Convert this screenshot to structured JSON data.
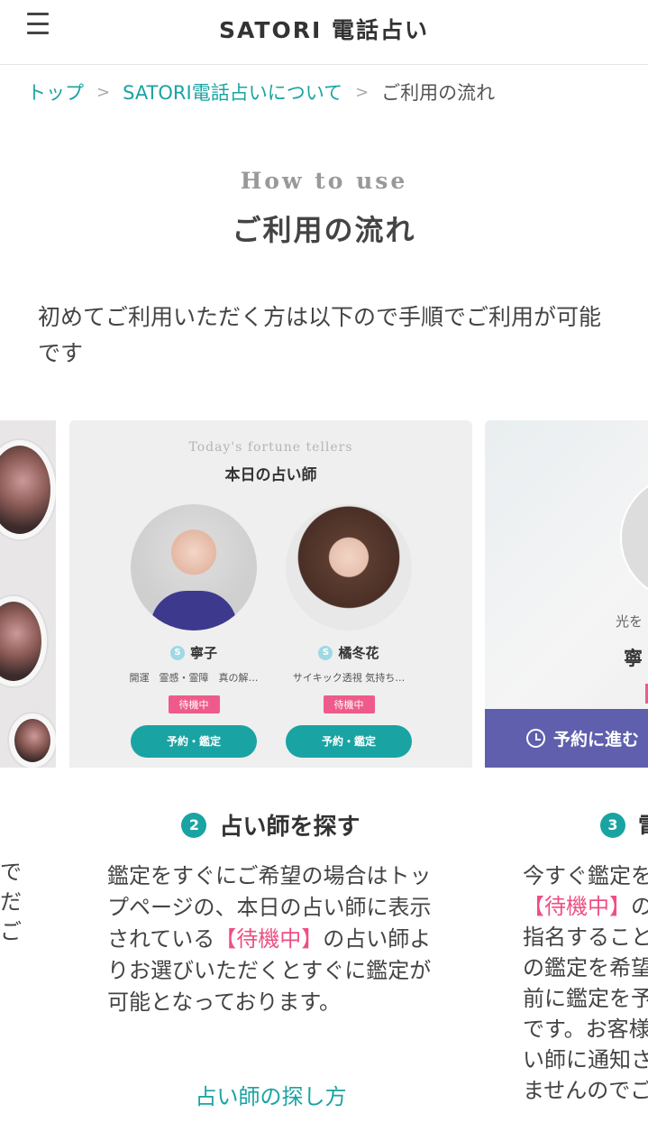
{
  "header": {
    "logo": "SATORI 電話占い",
    "menu_icon": "hamburger-icon"
  },
  "breadcrumb": {
    "items": [
      "トップ",
      "SATORI電話占いについて"
    ],
    "current": "ご利用の流れ",
    "separator": ">"
  },
  "page": {
    "en_title": "How to use",
    "title": "ご利用の流れ",
    "intro": "初めてご利用いただく方は以下ので手順でご利用が可能です"
  },
  "slides": {
    "left_partial": {
      "text_lines": [
        "で",
        "だ",
        "ご"
      ]
    },
    "main": {
      "shot": {
        "en_heading": "Today's fortune tellers",
        "heading": "本日の占い師",
        "tellers": [
          {
            "badge": "S",
            "name": "寧子",
            "tags": "開運　霊感・霊障　真の解…",
            "status": "待機中",
            "button": "予約・鑑定"
          },
          {
            "badge": "S",
            "name": "橘冬花",
            "tags": "サイキック透視 気持ち…",
            "status": "待機中",
            "button": "予約・鑑定"
          }
        ]
      },
      "step_number": "2",
      "step_title": "占い師を探す",
      "desc_before": "鑑定をすぐにご希望の場合はトップページの、本日の占い師に表示されている",
      "desc_highlight": "【待機中】",
      "desc_after": "の占い師よりお選びいただくとすぐに鑑定が可能となっております。",
      "link": "占い師の探し方"
    },
    "right_partial": {
      "shot_text1": "光を",
      "shot_text2": "寧",
      "reserve_bar": "予約に進む",
      "step_number": "3",
      "step_title": "電",
      "desc_lines_before": "今すぐ鑑定を",
      "desc_highlight": "【待機中】",
      "desc_highlight_after": "の",
      "desc_lines": [
        "指名すること",
        "の鑑定を希望",
        "前に鑑定を予",
        "です。お客様",
        "い師に通知さ",
        "ませんのでご"
      ]
    }
  },
  "colors": {
    "accent": "#1aa3a3",
    "highlight": "#ee4f82",
    "reserve_bar": "#5f5fae"
  }
}
